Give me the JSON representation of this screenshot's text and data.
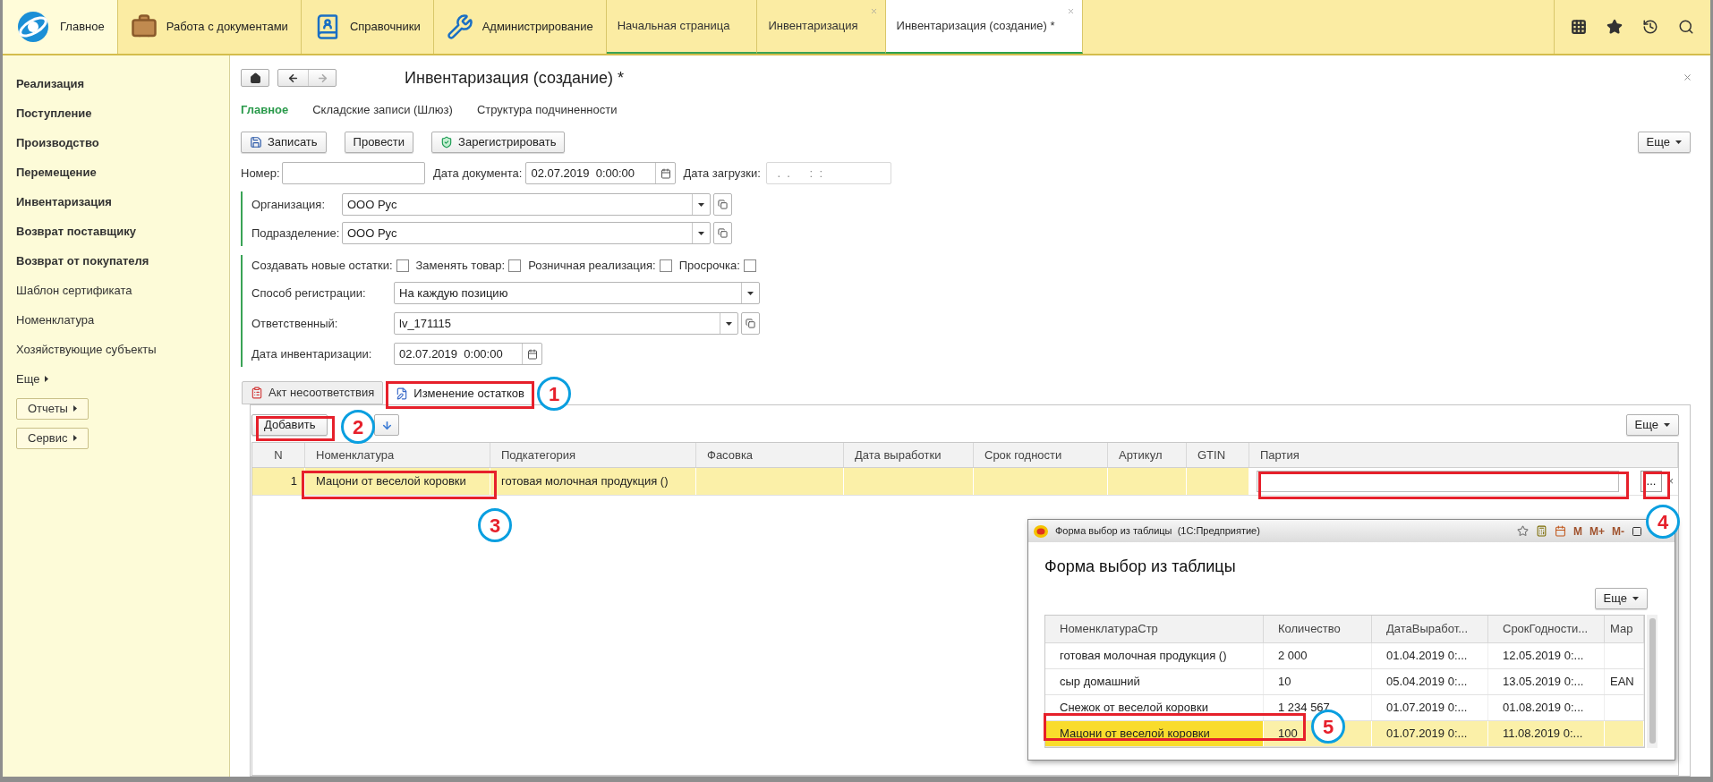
{
  "top_bar": {
    "sections": [
      {
        "label": "Главное",
        "kind": "home",
        "selected": true
      },
      {
        "label": "Работа с документами",
        "kind": "documents",
        "selected": false
      },
      {
        "label": "Справочники",
        "kind": "catalogs",
        "selected": false
      },
      {
        "label": "Администрирование",
        "kind": "admin",
        "selected": false
      }
    ],
    "open_tabs": [
      {
        "label": "Начальная страница",
        "selected": false,
        "closable": false
      },
      {
        "label": "Инвентаризация",
        "selected": false,
        "closable": true
      },
      {
        "label": "Инвентаризация (создание) *",
        "selected": true,
        "closable": true
      }
    ]
  },
  "sidebar": {
    "items": [
      {
        "label": "Реализация",
        "bold": true
      },
      {
        "label": "Поступление",
        "bold": true
      },
      {
        "label": "Производство",
        "bold": true
      },
      {
        "label": "Перемещение",
        "bold": true
      },
      {
        "label": "Инвентаризация",
        "bold": true
      },
      {
        "label": "Возврат поставщику",
        "bold": true
      },
      {
        "label": "Возврат от покупателя",
        "bold": true
      },
      {
        "label": "Шаблон сертификата",
        "bold": false
      },
      {
        "label": "Номенклатура",
        "bold": false
      },
      {
        "label": "Хозяйствующие субъекты",
        "bold": false
      }
    ],
    "more": "Еще",
    "buttons": [
      "Отчеты",
      "Сервис"
    ]
  },
  "form": {
    "title": "Инвентаризация (создание) *",
    "nav": [
      {
        "label": "Главное",
        "selected": true
      },
      {
        "label": "Складские записи (Шлюз)",
        "selected": false
      },
      {
        "label": "Структура подчиненности",
        "selected": false
      }
    ],
    "actions": [
      {
        "label": "Записать",
        "kind": "save"
      },
      {
        "label": "Провести",
        "kind": "plain"
      },
      {
        "label": "Зарегистрировать",
        "kind": "register"
      }
    ],
    "more": "Еще",
    "number": {
      "label": "Номер:"
    },
    "doc_date": {
      "label": "Дата документа:",
      "value": "02.07.2019  0:00:00"
    },
    "load_date": {
      "label": "Дата загрузки:",
      "placeholder": " .  .      :  :"
    },
    "org_fields": [
      {
        "label": "Организация:",
        "value": "ООО Рус"
      },
      {
        "label": "Подразделение:",
        "value": "ООО Рус"
      }
    ],
    "checkboxes": [
      {
        "label": "Создавать новые остатки:",
        "checked": false
      },
      {
        "label": "Заменять товар:",
        "checked": false
      },
      {
        "label": "Розничная реализация:",
        "checked": false
      },
      {
        "label": "Просрочка:",
        "checked": false
      }
    ],
    "registration": {
      "label": "Способ регистрации:",
      "value": "На каждую позицию"
    },
    "responsible": {
      "label": "Ответственный:",
      "value": "lv_171115"
    },
    "inventory_date": {
      "label": "Дата инвентаризации:",
      "value": "02.07.2019  0:00:00"
    },
    "tabs": [
      {
        "label": "Акт несоответствия",
        "selected": false,
        "kind": "act"
      },
      {
        "label": "Изменение остатков",
        "selected": true,
        "kind": "change"
      }
    ],
    "table": {
      "add_button": "Добавить",
      "more": "Еще",
      "columns": [
        "N",
        "Номенклатура",
        "Подкатегория",
        "Фасовка",
        "Дата выработки",
        "Срок годности",
        "Артикул",
        "GTIN",
        "Партия"
      ],
      "rows": [
        {
          "cells": [
            "1",
            "Мацони от веселой коровки",
            "готовая молочная продукция ()"
          ],
          "selected": true
        }
      ],
      "picker": "...",
      "clear": "×"
    }
  },
  "popup": {
    "window_title": "Форма выбор из таблицы  (1С:Предприятие)",
    "title_buttons": [
      "M",
      "M+",
      "M-"
    ],
    "heading": "Форма выбор из таблицы",
    "more": "Еще",
    "columns": [
      "НоменклатураСтр",
      "Количество",
      "ДатаВыработ...",
      "СрокГодности...",
      "Мар"
    ],
    "rows": [
      {
        "cells": [
          "готовая молочная продукция ()",
          "2 000",
          "01.04.2019 0:...",
          "12.05.2019 0:..."
        ],
        "selected": false
      },
      {
        "cells": [
          "сыр домашний",
          "10",
          "05.04.2019 0:...",
          "13.05.2019 0:...",
          "EAN"
        ],
        "selected": false
      },
      {
        "cells": [
          "Снежок от веселой коровки",
          "1 234 567",
          "01.07.2019 0:...",
          "01.08.2019 0:..."
        ],
        "selected": false
      },
      {
        "cells": [
          "Мацони от веселой коровки",
          "100",
          "01.07.2019 0:...",
          "11.08.2019 0:..."
        ],
        "selected": true
      }
    ]
  },
  "annotations": [
    "1",
    "2",
    "3",
    "4",
    "5"
  ]
}
